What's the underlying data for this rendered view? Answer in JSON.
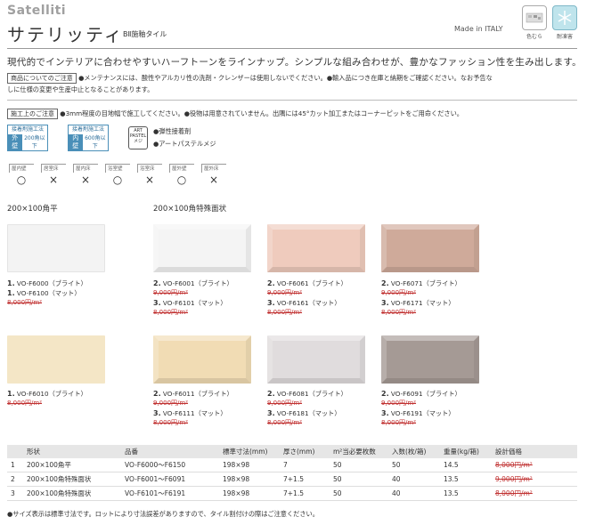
{
  "header": {
    "brand": "Satelliti",
    "title": "サテリッティ",
    "subtitle": "BⅡ施釉タイル",
    "made_in": "Made in ITALY",
    "badges": [
      {
        "name": "color-variation",
        "label": "色むら"
      },
      {
        "name": "frost-resistant",
        "label": "耐凍害"
      }
    ]
  },
  "lead": "現代的でインテリアに合わせやすいハーフトーンをラインナップ。シンプルな組み合わせが、豊かなファッション性を生み出します。",
  "product_note": {
    "tag": "商品についてのご注意",
    "line1": "●メンテナンスには、酸性やアルカリ性の洗剤・クレンザーは使用しないでください。●輸入品につき在庫と納期をご確認ください。なお予告な",
    "line2": "しに仕様の変更や生産中止となることがあります。"
  },
  "install_note": {
    "tag": "施工上のご注意",
    "text": "●3mm程度の目地幅で施工してください。●役物は用意されていません。出隅には45°カット加工またはコーナーピットをご用命ください。",
    "method1": {
      "top": "接着剤施工法",
      "label": "外壁",
      "value": "200角以下"
    },
    "method2": {
      "top": "接着剤施工法",
      "label": "内壁",
      "value": "600角以下"
    },
    "art_badge": [
      "ART",
      "PASTEL",
      "メジ"
    ],
    "adhesive": "●弾性接着剤",
    "grout": "●アートパステルメジ"
  },
  "usage": [
    {
      "label": "屋内壁",
      "mark": "○"
    },
    {
      "label": "居室床",
      "mark": "×"
    },
    {
      "label": "屋内床",
      "mark": "×"
    },
    {
      "label": "浴室壁",
      "mark": "○"
    },
    {
      "label": "浴室床",
      "mark": "×"
    },
    {
      "label": "屋外壁",
      "mark": "○"
    },
    {
      "label": "屋外床",
      "mark": "×"
    }
  ],
  "sections": {
    "flat": "200×100角平",
    "special": "200×100角特殊面状"
  },
  "products": [
    {
      "n1": "1.",
      "c1": "VO-F6000（ブライト）",
      "n2": "1.",
      "c2": "VO-F6100（マット）",
      "price": "8,000円/m²"
    },
    {
      "n1": "2.",
      "c1": "VO-F6001（ブライト）",
      "p1": "9,000円/m²",
      "n2": "3.",
      "c2": "VO-F6101（マット）",
      "p2": "8,000円/m²"
    },
    {
      "n1": "2.",
      "c1": "VO-F6061（ブライト）",
      "p1": "9,000円/m²",
      "n2": "3.",
      "c2": "VO-F6161（マット）",
      "p2": "8,000円/m²"
    },
    {
      "n1": "2.",
      "c1": "VO-F6071（ブライト）",
      "p1": "9,000円/m²",
      "n2": "3.",
      "c2": "VO-F6171（マット）",
      "p2": "8,000円/m²"
    },
    {
      "n1": "1.",
      "c1": "VO-F6010（ブライト）",
      "price": "8,000円/m²"
    },
    {
      "n1": "2.",
      "c1": "VO-F6011（ブライト）",
      "p1": "9,000円/m²",
      "n2": "3.",
      "c2": "VO-F6111（マット）",
      "p2": "8,000円/m²"
    },
    {
      "n1": "2.",
      "c1": "VO-F6081（ブライト）",
      "p1": "9,000円/m²",
      "n2": "3.",
      "c2": "VO-F6181（マット）",
      "p2": "8,000円/m²"
    },
    {
      "n1": "2.",
      "c1": "VO-F6091（ブライト）",
      "p1": "9,000円/m²",
      "n2": "3.",
      "c2": "VO-F6191（マット）",
      "p2": "8,000円/m²"
    }
  ],
  "tile_colors": [
    "#f3f3f3",
    "#f4f4f4",
    "#efcbbd",
    "#cfaa9a",
    "#f4e6c6",
    "#f1dcb4",
    "#e0dcdd",
    "#a59a95"
  ],
  "table": {
    "headers": [
      "",
      "形状",
      "品番",
      "標準寸法(mm)",
      "厚さ(mm)",
      "m²当必要枚数",
      "入数(枚/箱)",
      "重量(kg/箱)",
      "設計価格"
    ],
    "rows": [
      [
        "1",
        "200×100角平",
        "VO-F6000～F6150",
        "198×98",
        "7",
        "50",
        "50",
        "14.5",
        "8,000円/m²"
      ],
      [
        "2",
        "200×100角特殊面状",
        "VO-F6001～F6091",
        "198×98",
        "7+1.5",
        "50",
        "40",
        "13.5",
        "9,000円/m²"
      ],
      [
        "3",
        "200×100角特殊面状",
        "VO-F6101～F6191",
        "198×98",
        "7+1.5",
        "50",
        "40",
        "13.5",
        "8,000円/m²"
      ]
    ]
  },
  "footnote": "●サイズ表示は標準寸法です。ロットにより寸法誤差がありますので、タイル割付けの際はご注意ください。"
}
